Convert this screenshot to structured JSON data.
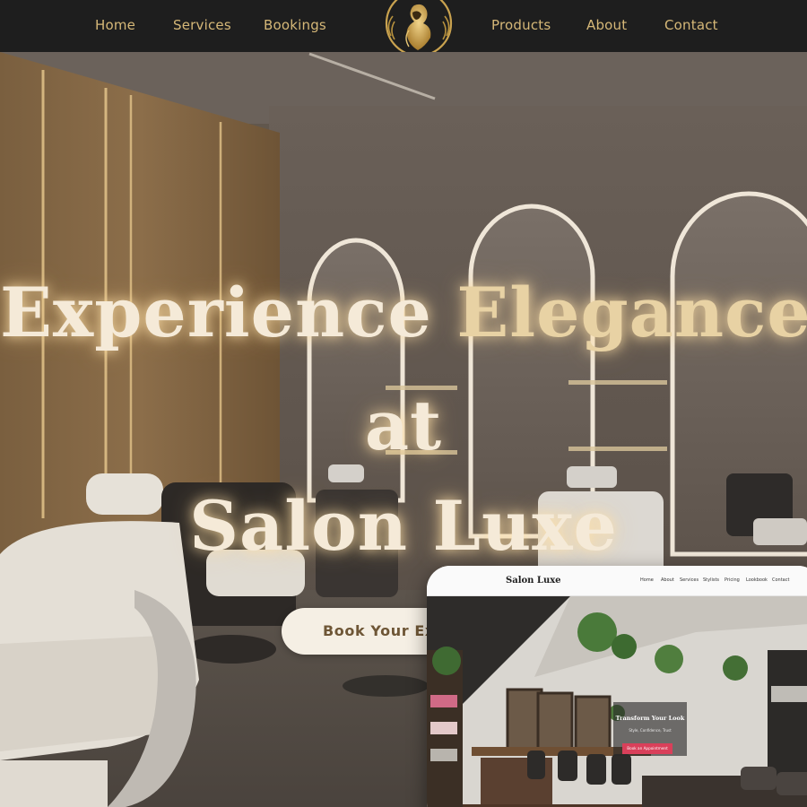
{
  "nav": {
    "left_items": [
      "Home",
      "Services",
      "Bookings"
    ],
    "right_items": [
      "Products",
      "About",
      "Contact"
    ],
    "logo_icon": "gold-woman-silhouette-logo-icon"
  },
  "hero": {
    "headline_part1": "Experience",
    "headline_part2": "Elegance",
    "headline_line2": "at",
    "headline_line3": "Salon Luxe",
    "cta_label": "Book Your Exp"
  },
  "preview": {
    "brand": "Salon Luxe",
    "nav_items": [
      "Home",
      "About",
      "Services",
      "Stylists",
      "Pricing",
      "Lookbook",
      "Contact"
    ],
    "hero_title": "Transform Your Look",
    "hero_subtitle": "Style, Confidence, Trust",
    "hero_button": "Book an Appointment"
  },
  "colors": {
    "nav_bg": "#1e1e1e",
    "nav_text": "#d6b878",
    "gold": "#c9a24f",
    "headline": "#f5ead8",
    "cta_bg": "#f5efe4",
    "cta_text": "#6e5636",
    "preview_button": "#d9405a"
  }
}
